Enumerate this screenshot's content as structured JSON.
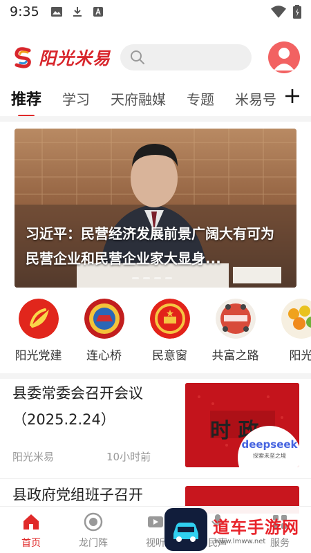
{
  "status_bar": {
    "time": "9:35"
  },
  "header": {
    "brand": "阳光米易",
    "search_placeholder": ""
  },
  "tabs": [
    {
      "label": "推荐",
      "active": true
    },
    {
      "label": "学习"
    },
    {
      "label": "天府融媒"
    },
    {
      "label": "专题"
    },
    {
      "label": "米易号"
    }
  ],
  "banner": {
    "caption": "习近平：民营经济发展前景广阔大有可为 民营企业和民营企业家大显身..."
  },
  "quick_entries": [
    {
      "label": "阳光党建",
      "icon": "party-emblem-icon"
    },
    {
      "label": "连心桥",
      "icon": "cppcc-emblem-icon"
    },
    {
      "label": "民意窗",
      "icon": "national-emblem-icon"
    },
    {
      "label": "共富之路",
      "icon": "common-prosperity-icon"
    },
    {
      "label": "阳光",
      "icon": "fruit-icon"
    }
  ],
  "news": [
    {
      "title": "县委常委会召开会议（2025.2.24）",
      "source": "阳光米易",
      "time": "10小时前",
      "thumb_text": "时 政",
      "thumb_badge": "deepseek",
      "thumb_badge_sub": "探索未至之境"
    },
    {
      "title": "县政府党组班子召开"
    }
  ],
  "bottom_nav": [
    {
      "label": "首页",
      "active": true,
      "icon": "home-icon"
    },
    {
      "label": "龙门阵",
      "icon": "target-icon"
    },
    {
      "label": "视听",
      "icon": "video-icon"
    },
    {
      "label": "民声",
      "icon": "voice-icon"
    },
    {
      "label": "服务",
      "icon": "service-icon"
    }
  ],
  "watermark": {
    "text": "道车手游网",
    "sub": "www.lmww.net"
  },
  "colors": {
    "accent": "#e02a2a",
    "brand": "#d8262c"
  }
}
